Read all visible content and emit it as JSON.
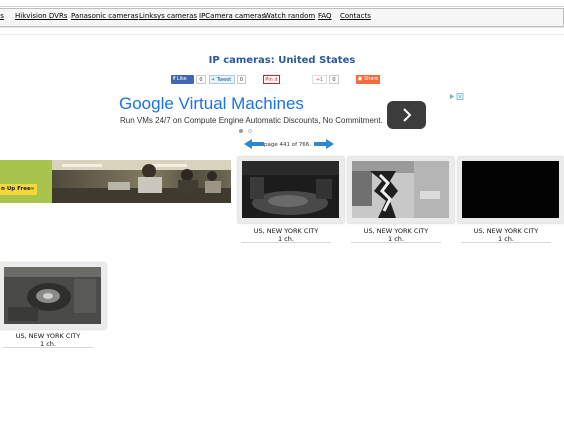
{
  "nav": {
    "items": [
      "as",
      "Hikvision DVRs",
      "Panasonic cameras",
      "Linksys cameras",
      "IPCamera cameras",
      "Watch random",
      "FAQ",
      "Contacts"
    ]
  },
  "page": {
    "title": "IP cameras: United States"
  },
  "share": {
    "fb_label": "Like",
    "fb_count": "0",
    "tw_label": "Tweet",
    "tw_count": "0",
    "pin_label": "Pin it",
    "gplus_label": "+1",
    "gplus_count": "0",
    "share_label": "Share"
  },
  "ad": {
    "title": "Google Virtual Machines",
    "subtitle": "Run VMs 24/7 on Compute Engine Automatic Discounts, No Commitment."
  },
  "pager": {
    "text": "page 441 of 766."
  },
  "banner": {
    "cta": "n Up Free»"
  },
  "cameras": [
    {
      "location": "US, NEW YORK CITY",
      "channels": "1 ch."
    },
    {
      "location": "US, NEW YORK CITY",
      "channels": "1 ch."
    },
    {
      "location": "US, NEW YORK CITY",
      "channels": "1 ch."
    },
    {
      "location": "US, NEW YORK CITY",
      "channels": "1 ch."
    }
  ],
  "colors": {
    "title": "#2a5a9e",
    "ad_title": "#1a73e8",
    "pager_arrow": "#2b86d4"
  }
}
